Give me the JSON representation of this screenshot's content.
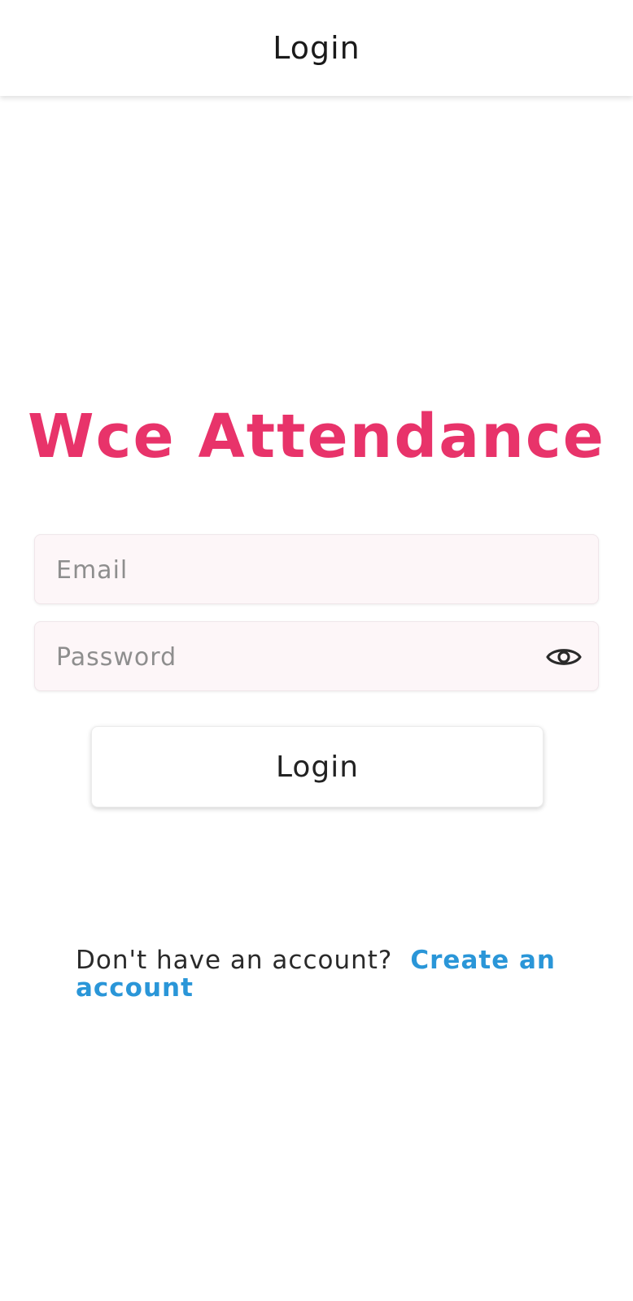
{
  "app_bar": {
    "title": "Login"
  },
  "brand": {
    "title": "Wce Attendance",
    "color": "#e8336a"
  },
  "form": {
    "email": {
      "placeholder": "Email",
      "value": ""
    },
    "password": {
      "placeholder": "Password",
      "value": "",
      "toggle_icon": "eye-icon"
    },
    "login_label": "Login"
  },
  "signup": {
    "prompt": "Don't have an account?",
    "link_label": "Create an account",
    "link_color": "#2a96d8"
  }
}
